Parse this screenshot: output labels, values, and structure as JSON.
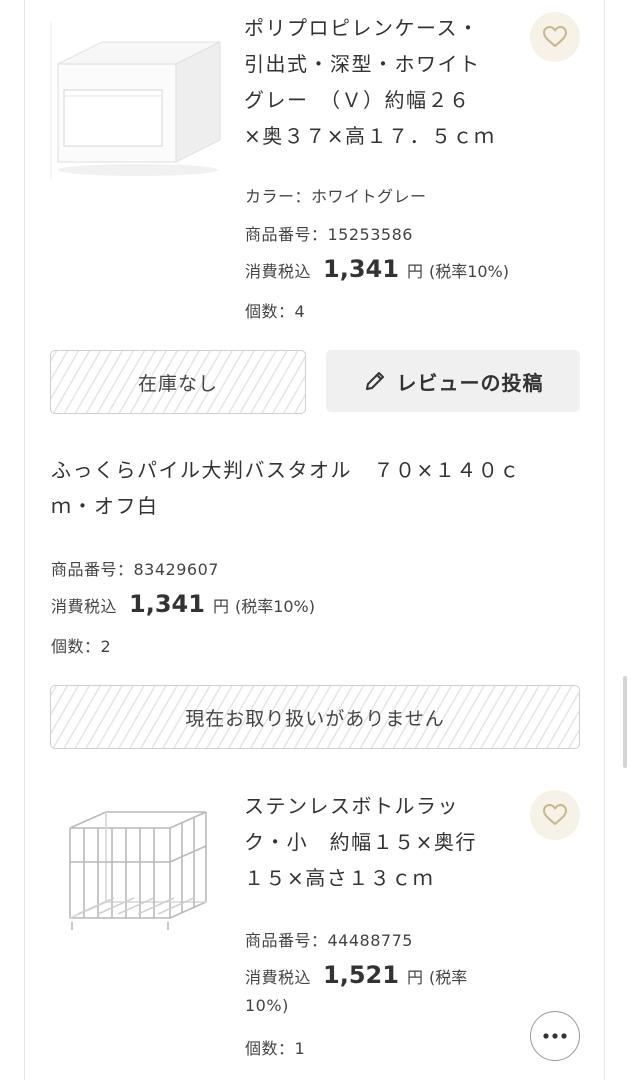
{
  "items": [
    {
      "title_lines": [
        "ポリプロピレンケース・",
        "引出式・深型・ホワイト",
        "グレー　（Ｖ）約幅２６",
        "×奥３７×高１７．５ｃｍ"
      ],
      "color": "カラー：ホワイトグレー",
      "product_number": "商品番号：15253586",
      "price_label": "消費税込",
      "price": "1,341",
      "currency": "円",
      "tax_note": "(税率10%)",
      "quantity": "個数：4",
      "stock_button": "在庫なし",
      "review_button": "レビューの投稿",
      "favorite_icon": "heart-icon",
      "image": "white drawer storage case"
    },
    {
      "title_lines": [
        "ふっくらパイル大判バスタオル　７０×１４０ｃ",
        "ｍ・オフ白"
      ],
      "product_number": "商品番号：83429607",
      "price_label": "消費税込",
      "price": "1,341",
      "currency": "円",
      "tax_note": "(税率10%)",
      "quantity": "個数：2",
      "unavailable_button": "現在お取り扱いがありません"
    },
    {
      "title_lines": [
        "ステンレスボトルラッ",
        "ク・小　約幅１５×奥行",
        "１５×高さ１３ｃｍ"
      ],
      "product_number": "商品番号：44488775",
      "price_label": "消費税込",
      "price": "1,521",
      "currency": "円",
      "tax_note_lines": [
        "(税率",
        "10%)"
      ],
      "quantity": "個数：1",
      "favorite_icon": "heart-icon",
      "more_icon": "more-dots-icon",
      "image": "stainless wire rack basket"
    }
  ],
  "colors": {
    "favorite_bg": "#f6f2e8",
    "favorite_heart": "#c9b68c",
    "button_gray": "#f0f0f0",
    "hatch": "#e5e5e5"
  }
}
